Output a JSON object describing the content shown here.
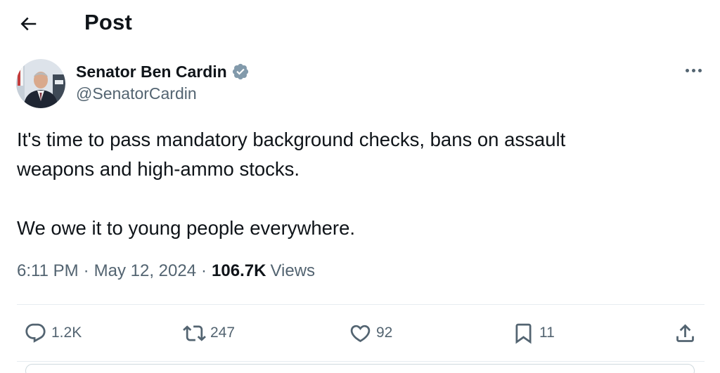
{
  "header": {
    "back_icon": "arrow-left-icon",
    "title": "Post"
  },
  "author": {
    "name": "Senator Ben Cardin",
    "handle": "@SenatorCardin",
    "verified_icon": "verified-badge-icon",
    "avatar": "avatar-photo"
  },
  "post": {
    "paragraphs": [
      "It's time to pass mandatory background checks, bans on assault",
      "weapons and high-ammo stocks.",
      "We owe it to young people everywhere."
    ]
  },
  "meta": {
    "time": "6:11 PM",
    "date": "May 12, 2024",
    "separator": "·",
    "views_count": "106.7K",
    "views_label": "Views"
  },
  "actions": {
    "replies": {
      "icon": "reply-icon",
      "count": "1.2K"
    },
    "reposts": {
      "icon": "repost-icon",
      "count": "247"
    },
    "likes": {
      "icon": "heart-icon",
      "count": "92"
    },
    "bookmarks": {
      "icon": "bookmark-icon",
      "count": "11"
    },
    "share": {
      "icon": "share-icon"
    }
  },
  "colors": {
    "text_primary": "#0f1419",
    "text_secondary": "#536471",
    "verified_badge": "#829aab",
    "divider": "#e6ecf0"
  }
}
